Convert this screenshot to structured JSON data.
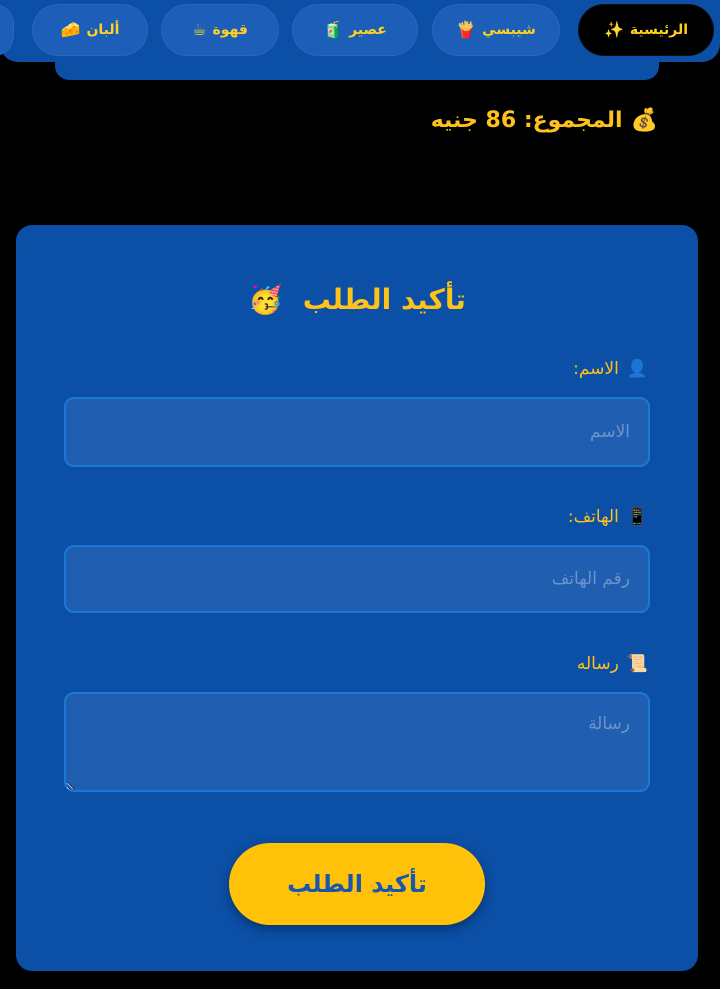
{
  "nav": {
    "tabs": [
      {
        "label": "الرئيسية",
        "icon": "✨",
        "active": true
      },
      {
        "label": "شيبسي",
        "icon": "🍟",
        "active": false
      },
      {
        "label": "عصير",
        "icon": "🧃",
        "active": false
      },
      {
        "label": "قهوة",
        "icon": "☕",
        "active": false
      },
      {
        "label": "ألبان",
        "icon": "🧀",
        "active": false
      }
    ]
  },
  "summary": {
    "total_text": "المجموع: 86 جنيه",
    "icon": "💰"
  },
  "order_form": {
    "title": "تأكيد الطلب",
    "title_icon": "🥳",
    "name": {
      "label": "الاسم:",
      "icon": "👤",
      "placeholder": "الاسم",
      "value": ""
    },
    "phone": {
      "label": "الهاتف:",
      "icon": "📱",
      "placeholder": "رقم الهاتف",
      "value": ""
    },
    "message": {
      "label": "رساله",
      "icon": "📜",
      "placeholder": "رسالة",
      "value": ""
    },
    "submit_label": "تأكيد الطلب"
  },
  "colors": {
    "accent_yellow": "#ffc21a",
    "primary_blue": "#0b4fa6",
    "input_blue": "#1f5eb1",
    "background": "#000000"
  }
}
